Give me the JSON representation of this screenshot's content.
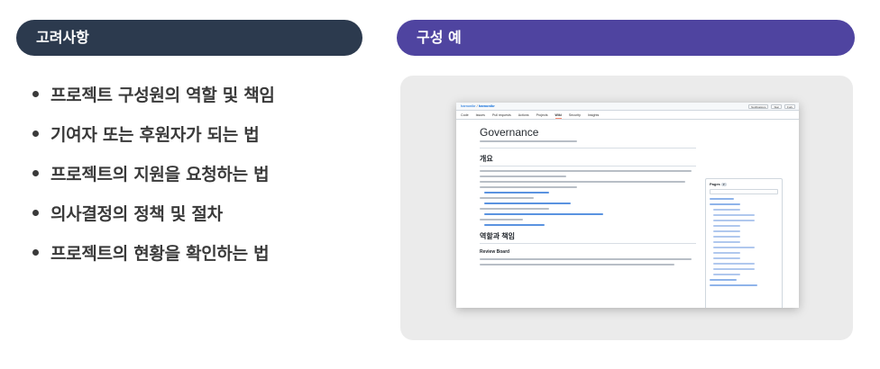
{
  "left_header": "고려사항",
  "right_header": "구성 예",
  "considerations": [
    "프로젝트 구성원의 역할 및 책임",
    "기여자 또는 후원자가 되는 법",
    "프로젝트의 지원을 요청하는 법",
    "의사결정의 정책 및 절차",
    "프로젝트의 현황을 확인하는 법"
  ],
  "screenshot": {
    "repo_owner": "hamonikr",
    "repo_name": "hamonikr",
    "top_buttons": [
      "Notifications",
      "Star",
      "Fork"
    ],
    "tabs": [
      "Code",
      "Issues",
      "Pull requests",
      "Actions",
      "Projects",
      "Wiki",
      "Security",
      "Insights"
    ],
    "active_tab": "Wiki",
    "wiki_title": "Governance",
    "section_overview": "개요",
    "section_roles": "역할과 책임",
    "subsection_review": "Review Board",
    "sidebar_pages": "Pages",
    "sidebar_page_count": "7"
  }
}
